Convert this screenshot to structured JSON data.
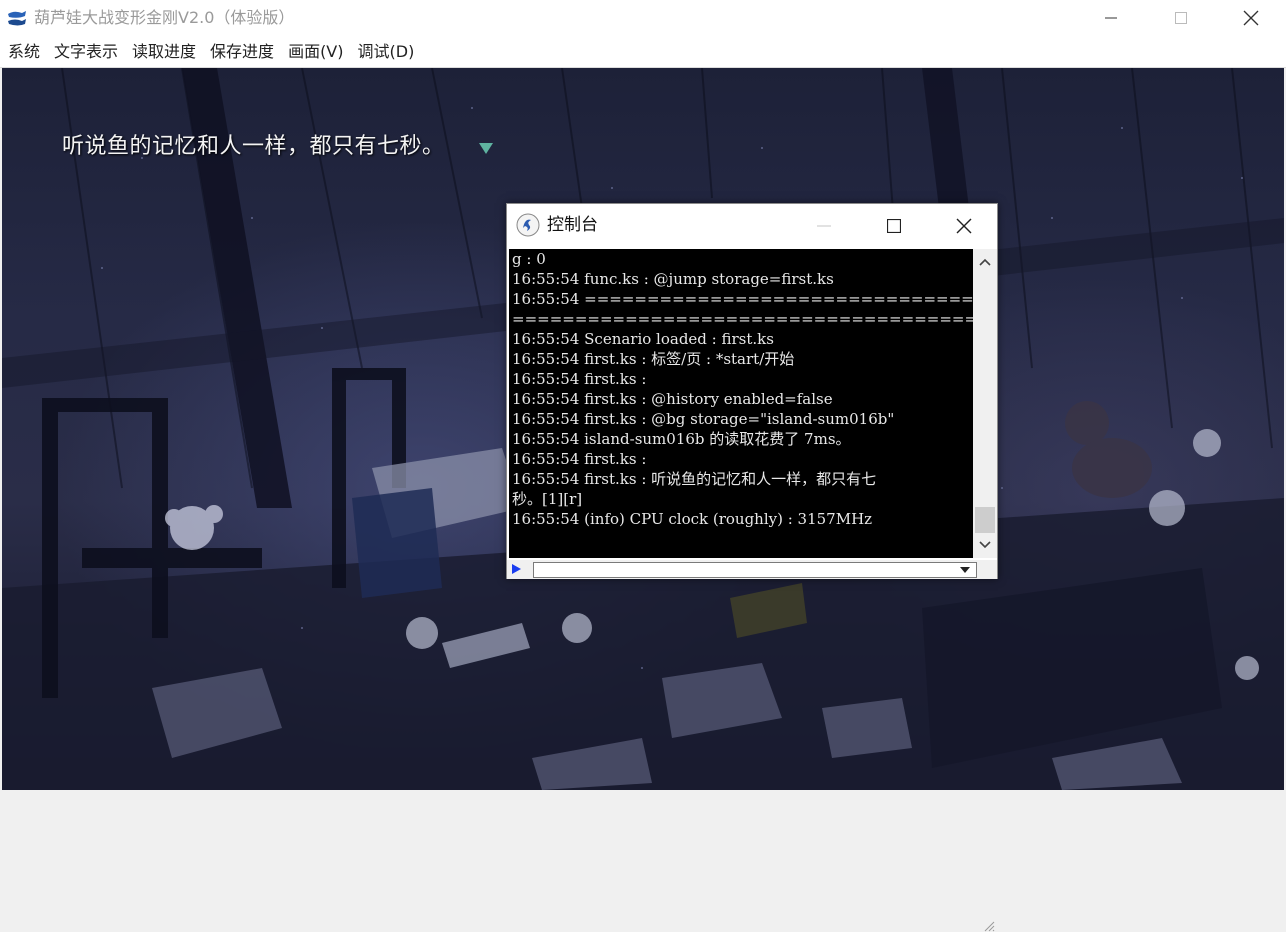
{
  "window": {
    "title": "葫芦娃大战变形金刚V2.0（体验版）"
  },
  "menu": [
    {
      "label": "系统"
    },
    {
      "label": "文字表示"
    },
    {
      "label": "读取进度"
    },
    {
      "label": "保存进度"
    },
    {
      "label": "画面(V)"
    },
    {
      "label": "调试(D)"
    }
  ],
  "scene": {
    "narration": "听说鱼的记忆和人一样，都只有七秒。"
  },
  "console": {
    "title": "控制台",
    "log": [
      "g : 0",
      "16:55:54 func.ks : @jump storage=first.ks",
      "16:55:54 ========================================",
      "========================================",
      "16:55:54 Scenario loaded : first.ks",
      "16:55:54 first.ks : 标签/页 : *start/开始",
      "16:55:54 first.ks :",
      "16:55:54 first.ks : @history enabled=false",
      "16:55:54 first.ks : @bg storage=\"island-sum016b\"",
      "16:55:54 island-sum016b 的读取花费了 7ms。",
      "16:55:54 first.ks :",
      "16:55:54 first.ks : 听说鱼的记忆和人一样，都只有七",
      "秒。[1][r]",
      "16:55:54 (info) CPU clock (roughly) : 3157MHz"
    ],
    "input_value": ""
  },
  "colors": {
    "accent_marker": "#5fb3a0",
    "console_bg": "#000000",
    "console_text": "#e8e8e8",
    "prompt": "#1a3df0"
  }
}
